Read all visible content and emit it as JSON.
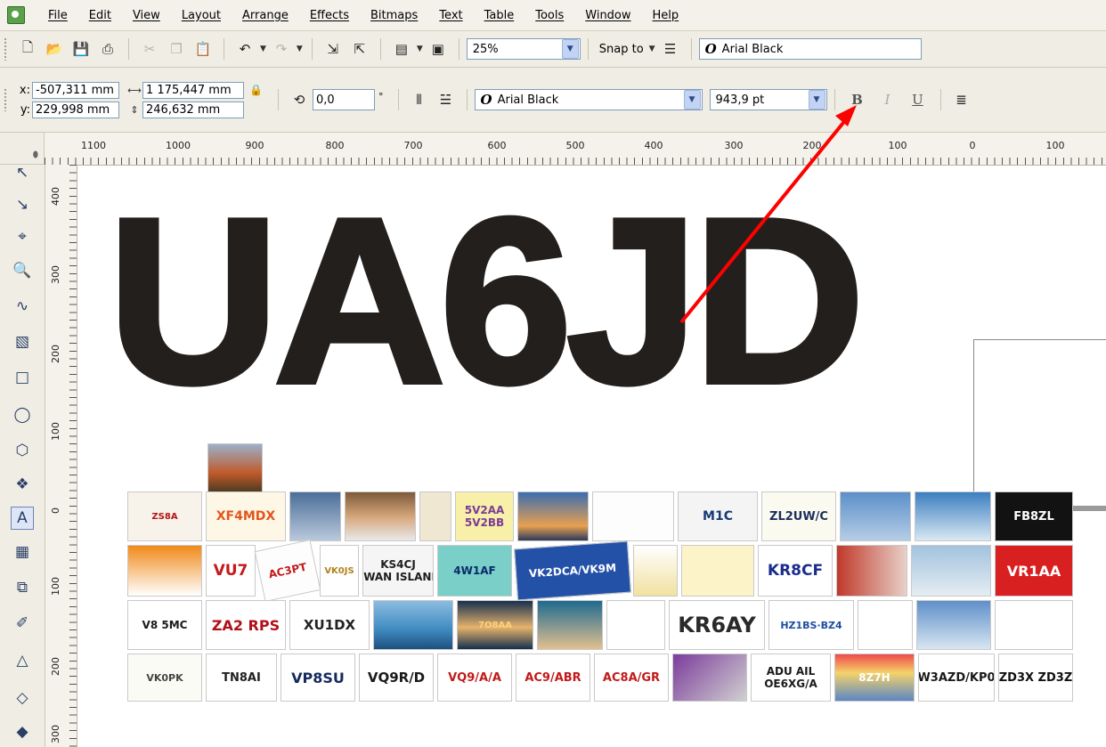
{
  "menubar": {
    "items": [
      "File",
      "Edit",
      "View",
      "Layout",
      "Arrange",
      "Effects",
      "Bitmaps",
      "Text",
      "Table",
      "Tools",
      "Window",
      "Help"
    ]
  },
  "standard_toolbar": {
    "zoom_value": "25%",
    "snap_label": "Snap to",
    "font_name": "Arial Black"
  },
  "property_bar": {
    "x_label": "x:",
    "y_label": "y:",
    "x_value": "-507,311 mm",
    "y_value": "229,998 mm",
    "width_value": "1 175,447 mm",
    "height_value": "246,632 mm",
    "rotation_value": "0,0",
    "degree_symbol": "°",
    "font_name": "Arial Black",
    "font_size": "943,9 pt"
  },
  "ruler": {
    "h_labels": [
      "1100",
      "1000",
      "900",
      "800",
      "700",
      "600",
      "500",
      "400",
      "300",
      "200",
      "100",
      "0",
      "100"
    ],
    "v_labels": [
      "400",
      "300",
      "200",
      "100",
      "0",
      "100",
      "200",
      "300"
    ]
  },
  "canvas": {
    "big_text": "UA6JD",
    "qsl_cards": [
      "ZS8A",
      "XF4MDX",
      "AC3PT",
      "5V2AA",
      "5V2BB",
      "M1C",
      "ZL2UW/C",
      "FB8ZL",
      "VU7",
      "VK0JS",
      "SWAN ISLAND",
      "KS4CJ",
      "4W1AF",
      "VK2DCA/VK9M",
      "KR8CF",
      "VR1AA",
      "V8 5MC",
      "ZA2 RPS",
      "XU1DX",
      "7O8AA",
      "KR6AY",
      "HZ1BS·BZ4",
      "VK0PK",
      "TN8AI",
      "VP8SU",
      "VQ9R/D",
      "VQ9/A/A",
      "AC9/ABR",
      "AC8A/GR",
      "ADU AIL",
      "OE6XG/A",
      "8Z7H",
      "W3AZD/KP0",
      "ZD3X ZD3Z"
    ]
  },
  "colors": {
    "annotation_arrow": "#ff0000",
    "big_text": "#231f1c",
    "chrome": "#efede4"
  }
}
